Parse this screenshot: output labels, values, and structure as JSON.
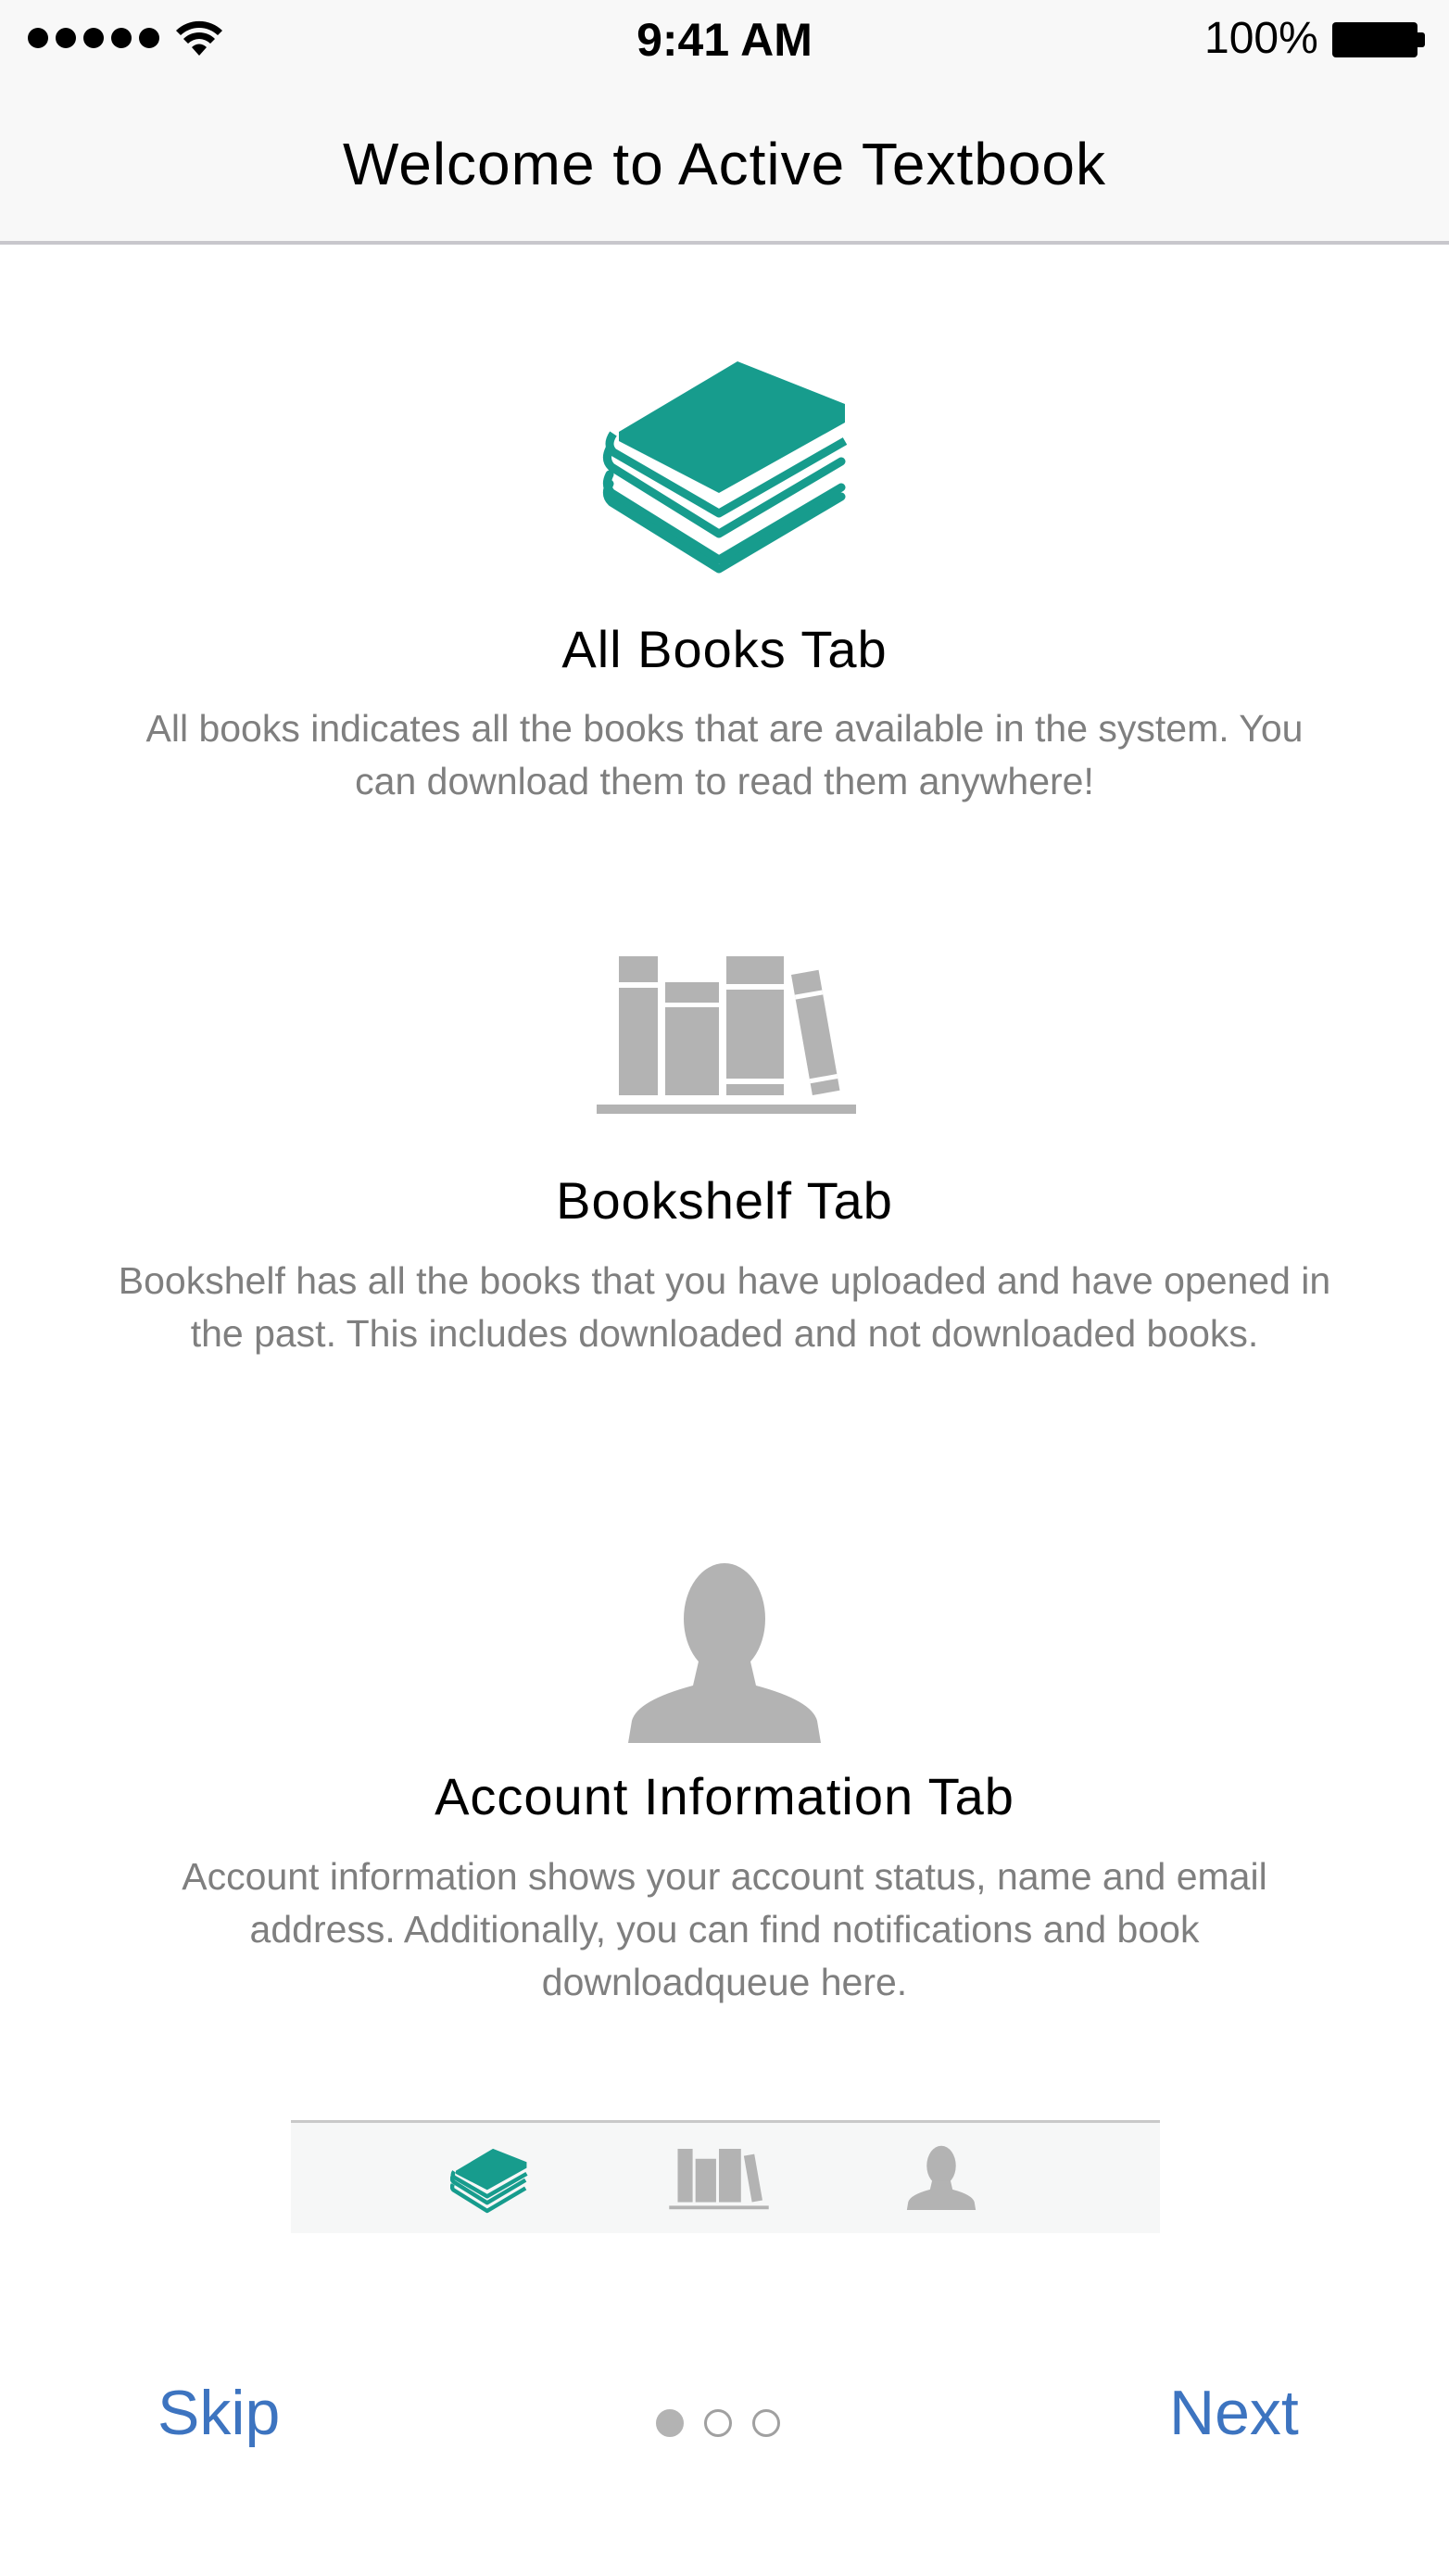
{
  "status_bar": {
    "time": "9:41 AM",
    "battery_percent": "100%",
    "signal_bars": 5
  },
  "nav": {
    "title": "Welcome to Active Textbook"
  },
  "features": [
    {
      "icon": "book-stack-icon",
      "title": "All Books Tab",
      "description": "All books indicates all the books that are available in the system. You can download them to read them anywhere!"
    },
    {
      "icon": "bookshelf-icon",
      "title": "Bookshelf Tab",
      "description": "Bookshelf has all the books that you have uploaded and have opened in the past. This includes downloaded and not downloaded books."
    },
    {
      "icon": "person-icon",
      "title": "Account Information Tab",
      "description": "Account information shows your account status, name and email address. Additionally, you can find notifications and book downloadqueue here."
    }
  ],
  "tabbar_preview": {
    "tabs": [
      "book-stack-icon",
      "bookshelf-icon",
      "person-icon"
    ],
    "active_index": 0
  },
  "footer": {
    "skip_label": "Skip",
    "next_label": "Next",
    "page_count": 3,
    "current_page": 1
  },
  "colors": {
    "accent_teal": "#179c8d",
    "icon_gray": "#b3b3b3",
    "link_blue": "#3d74c0",
    "desc_gray": "#7f7f7f"
  }
}
